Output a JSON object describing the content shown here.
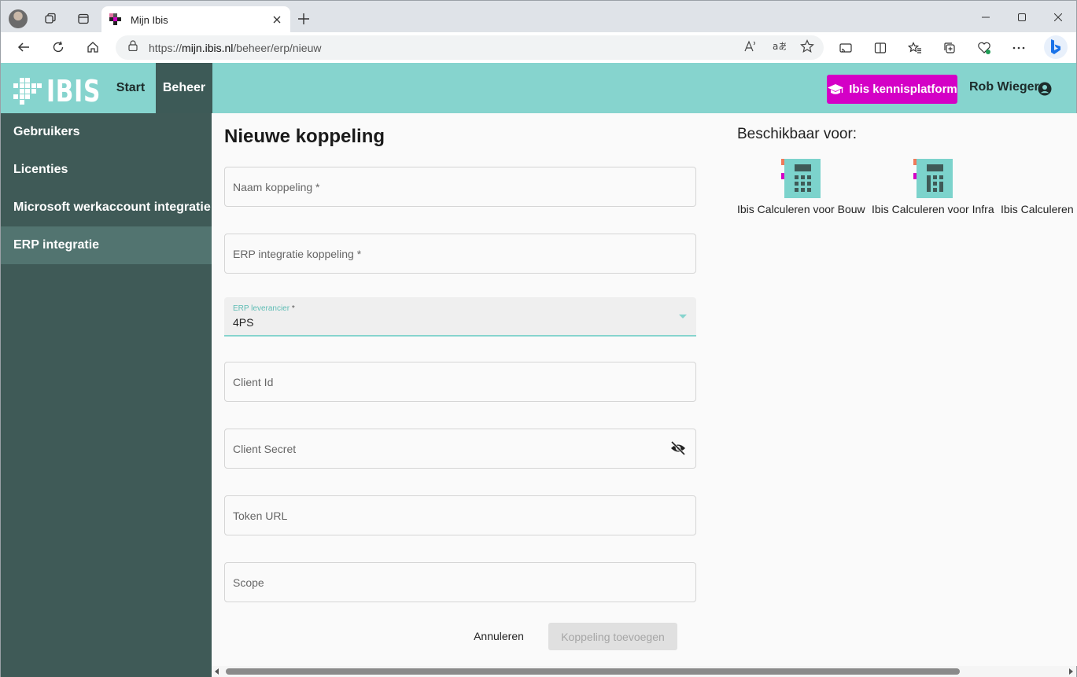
{
  "browser": {
    "tab_title": "Mijn Ibis",
    "url_prefix": "https://",
    "url_host": "mijn.ibis.nl",
    "url_path": "/beheer/erp/nieuw"
  },
  "header": {
    "logo_text": "IBIS",
    "nav": [
      "Start",
      "Beheer"
    ],
    "kennis_button": "Ibis kennisplatform",
    "user_name": "Rob Wiegers",
    "accent_color": "#86d4ce",
    "brand_magenta": "#d400c6"
  },
  "sidebar": {
    "items": [
      {
        "label": "Gebruikers",
        "active": false
      },
      {
        "label": "Licenties",
        "active": false
      },
      {
        "label": "Microsoft werkaccount integratie",
        "active": false
      },
      {
        "label": "ERP integratie",
        "active": true
      }
    ]
  },
  "form": {
    "title": "Nieuwe koppeling",
    "naam_label": "Naam koppeling *",
    "erp_koppeling_label": "ERP integratie koppeling *",
    "leverancier_label": "ERP leverancier",
    "leverancier_required": " *",
    "leverancier_value": "4PS",
    "client_id_label": "Client Id",
    "client_secret_label": "Client Secret",
    "token_url_label": "Token URL",
    "scope_label": "Scope",
    "cancel_button": "Annuleren",
    "submit_button": "Koppeling toevoegen"
  },
  "availability": {
    "title": "Beschikbaar voor:",
    "products": [
      {
        "label": "Ibis Calculeren voor Bouw",
        "icon": "calculator-icon"
      },
      {
        "label": "Ibis Calculeren voor Infra",
        "icon": "calculator-infra-icon"
      },
      {
        "label": "Ibis Calculeren",
        "icon": "calculator-icon"
      }
    ]
  }
}
